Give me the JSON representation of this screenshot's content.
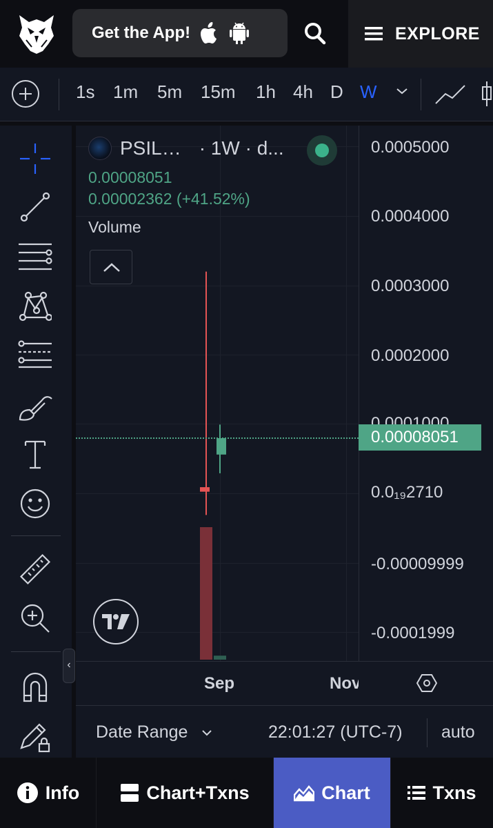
{
  "header": {
    "get_app_label": "Get the App!",
    "explore_label": "EXPLORE"
  },
  "timeframes": {
    "items": [
      "1s",
      "1m",
      "5m",
      "15m",
      "1h",
      "4h",
      "D",
      "W"
    ],
    "active": "W"
  },
  "legend": {
    "symbol": "PSIL…",
    "interval_source": "· 1W · d...",
    "price": "0.00008051",
    "change": "0.00002362 (+41.52%)",
    "volume_label": "Volume"
  },
  "price_scale": {
    "labels": [
      "0.0005000",
      "0.0004000",
      "0.0003000",
      "0.0002000",
      "0.0001000",
      "0.0₁₉2710",
      "-0.00009999",
      "-0.0001999"
    ],
    "current_price": "0.00008051"
  },
  "time_axis": {
    "labels": [
      "Sep",
      "Nov"
    ]
  },
  "chart_footer": {
    "date_range_label": "Date Range",
    "time_label": "22:01:27 (UTC-7)",
    "scale_mode": "auto"
  },
  "bottom_nav": {
    "items": [
      {
        "label": "Info"
      },
      {
        "label": "Chart+Txns"
      },
      {
        "label": "Chart"
      },
      {
        "label": "Txns"
      }
    ],
    "active": "Chart"
  },
  "colors": {
    "up": "#4fa586",
    "down": "#e55454",
    "active_tab": "#4b5cc4",
    "active_timeframe": "#2962ff"
  },
  "chart_data": {
    "type": "candlestick",
    "interval": "1W",
    "candles": [
      {
        "open": 1e-05,
        "high": 0.00032,
        "low": -3e-05,
        "close": 3.5e-06,
        "volume_direction": "down"
      },
      {
        "open": 5.69e-05,
        "high": 0.0001,
        "low": 3e-05,
        "close": 8.051e-05,
        "volume_direction": "up"
      }
    ],
    "ylim": [
      -0.00024,
      0.00053
    ],
    "x_tick_labels": [
      "Sep",
      "Nov"
    ]
  }
}
